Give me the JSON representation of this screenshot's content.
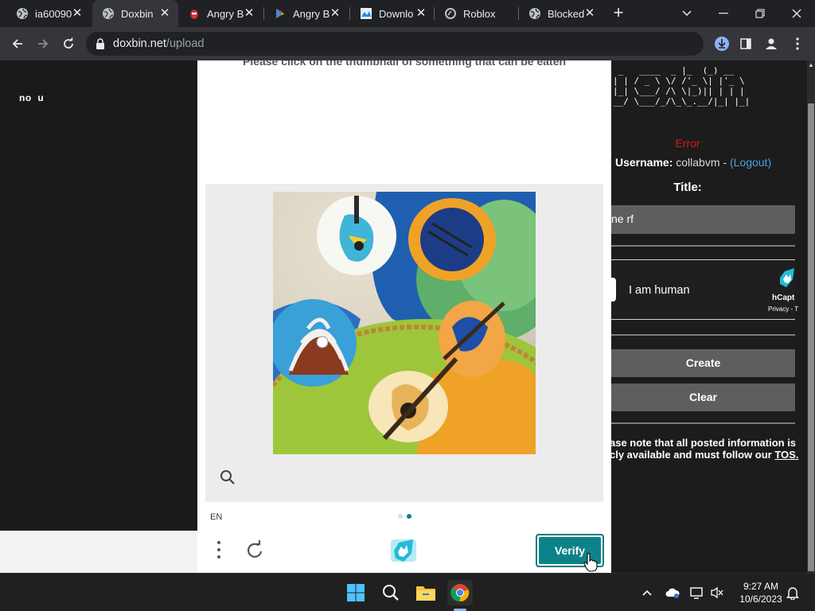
{
  "browser": {
    "tabs": [
      {
        "label": "ia60090",
        "icon": "globe-icon",
        "active": false
      },
      {
        "label": "Doxbin",
        "icon": "globe-icon",
        "active": true
      },
      {
        "label": "Angry B",
        "icon": "angry-bird-icon",
        "active": false
      },
      {
        "label": "Angry B",
        "icon": "google-play-icon",
        "active": false
      },
      {
        "label": "Downlo",
        "icon": "download-site-icon",
        "active": false
      },
      {
        "label": "Roblox",
        "icon": "roblox-icon",
        "active": false
      },
      {
        "label": "Blocked",
        "icon": "globe-icon",
        "active": false
      }
    ],
    "url_host": "doxbin.net",
    "url_path": "/upload",
    "window_controls": [
      "chevron-down-icon",
      "minimize-icon",
      "restore-icon",
      "close-icon"
    ]
  },
  "left": {
    "text": "no  u"
  },
  "challenge": {
    "prompt": "Please click on the thumbnail of something that can be eaten",
    "language": "EN",
    "verify_label": "Verify",
    "accent": "#0d8389"
  },
  "right": {
    "ascii_logo": " _   ____  _ |_  (_) __\n| | / _ \\ \\/ /'_ \\| |'_ \\\n|_| \\___/ /\\ \\|_)|| | | |\n__/ \\___/_/\\_\\_.__/|_| |_|",
    "error": "Error",
    "username_label": "Username:",
    "username": "collabvm",
    "dash": "-",
    "logout": "(Logout)",
    "title_label": "Title:",
    "title_value": "ne rf",
    "hcaptcha_checkbox_label": "I am human",
    "hcaptcha_brand": "hCapt",
    "hcaptcha_links": "Privacy - T",
    "create_label": "Create",
    "clear_label": "Clear",
    "note_text": "ase note that all posted information is\ncly available and must follow our ",
    "note_link": "TOS.",
    "error_color": "#d71a1a",
    "link_color": "#4a9fdf"
  },
  "taskbar": {
    "time": "9:27 AM",
    "date": "10/6/2023",
    "pinned": [
      "windows-start-icon",
      "search-icon",
      "file-explorer-icon",
      "chrome-icon"
    ]
  }
}
